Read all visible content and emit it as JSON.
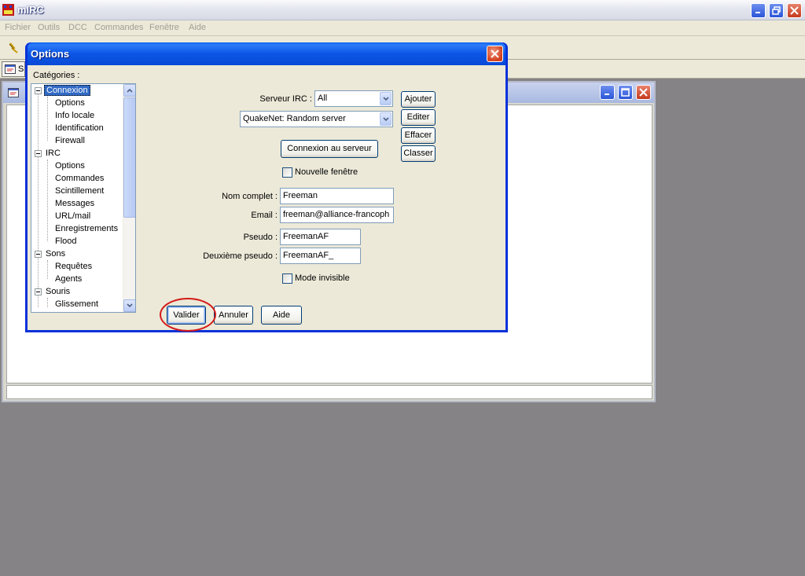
{
  "app": {
    "title": "mIRC"
  },
  "menu": [
    "Fichier",
    "Outils",
    "DCC",
    "Commandes",
    "Fenêtre",
    "Aide"
  ],
  "switchbar": {
    "item_label": "S"
  },
  "dialog": {
    "title": "Options",
    "categories_label": "Catégories :",
    "tree": [
      {
        "label": "Connexion",
        "level": 0,
        "selected": true
      },
      {
        "label": "Options",
        "level": 1
      },
      {
        "label": "Info locale",
        "level": 1
      },
      {
        "label": "Identification",
        "level": 1
      },
      {
        "label": "Firewall",
        "level": 1
      },
      {
        "label": "IRC",
        "level": 0
      },
      {
        "label": "Options",
        "level": 1
      },
      {
        "label": "Commandes",
        "level": 1
      },
      {
        "label": "Scintillement",
        "level": 1
      },
      {
        "label": "Messages",
        "level": 1
      },
      {
        "label": "URL/mail",
        "level": 1
      },
      {
        "label": "Enregistrements",
        "level": 1
      },
      {
        "label": "Flood",
        "level": 1
      },
      {
        "label": "Sons",
        "level": 0
      },
      {
        "label": "Requêtes",
        "level": 1
      },
      {
        "label": "Agents",
        "level": 1
      },
      {
        "label": "Souris",
        "level": 0
      },
      {
        "label": "Glissement",
        "level": 1
      }
    ],
    "server_label": "Serveur IRC :",
    "server_group": "All",
    "server": "QuakeNet: Random server",
    "buttons": {
      "add": "Ajouter",
      "edit": "Editer",
      "delete": "Effacer",
      "sort": "Classer",
      "connect": "Connexion au serveur",
      "ok": "Valider",
      "cancel": "Annuler",
      "help": "Aide"
    },
    "new_window_label": "Nouvelle fenêtre",
    "fullname_label": "Nom complet :",
    "fullname": "Freeman",
    "email_label": "Email :",
    "email": "freeman@alliance-francoph",
    "nick_label": "Pseudo :",
    "nick": "FreemanAF",
    "alt_nick_label": "Deuxième pseudo :",
    "alt_nick": "FreemanAF_",
    "invisible_label": "Mode invisible"
  },
  "colors": {
    "dialog_title": "#0a4ad6",
    "highlight": "#d41a1a",
    "desktop": "#858385"
  }
}
